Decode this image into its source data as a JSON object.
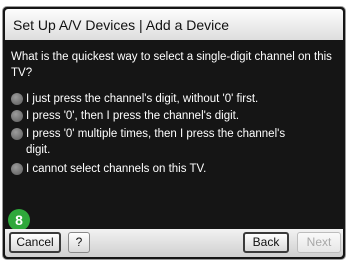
{
  "dialog": {
    "title": "Set Up A/V Devices | Add a Device"
  },
  "question": "What is the quickest way to select a single-digit channel on this TV?",
  "options": [
    {
      "label": "I just press the channel's digit, without '0' first."
    },
    {
      "label": "I press '0', then I press the channel's digit."
    },
    {
      "label": "I press '0' multiple times, then I press the channel's digit."
    },
    {
      "label": "I cannot select channels on this TV."
    }
  ],
  "badge": {
    "text": "8",
    "color": "#2fa83b"
  },
  "buttons": {
    "cancel": "Cancel",
    "help": "?",
    "back": "Back",
    "next": "Next"
  }
}
